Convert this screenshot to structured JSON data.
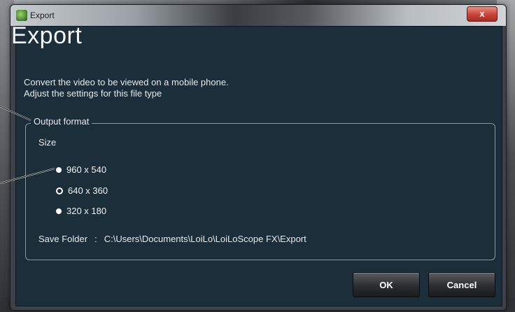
{
  "window": {
    "title": "Export",
    "close_label": "x"
  },
  "main": {
    "heading": "Export",
    "description_line1": "Convert the video to be viewed on a mobile phone.",
    "description_line2": "Adjust the settings for this file type"
  },
  "output_format": {
    "legend": "Output format",
    "size_label": "Size",
    "options": [
      {
        "label": "960 x 540",
        "selected": false
      },
      {
        "label": "640 x 360",
        "selected": true
      },
      {
        "label": "320 x 180",
        "selected": false
      }
    ],
    "save_folder_label": "Save Folder",
    "save_folder_separator": ":",
    "save_folder_path": "C:\\Users\\Documents\\LoiLo\\LoiLoScope FX\\Export"
  },
  "buttons": {
    "ok": "OK",
    "cancel": "Cancel"
  },
  "colors": {
    "panel_bg": "#1d2e3b",
    "close_red": "#c6443a"
  }
}
